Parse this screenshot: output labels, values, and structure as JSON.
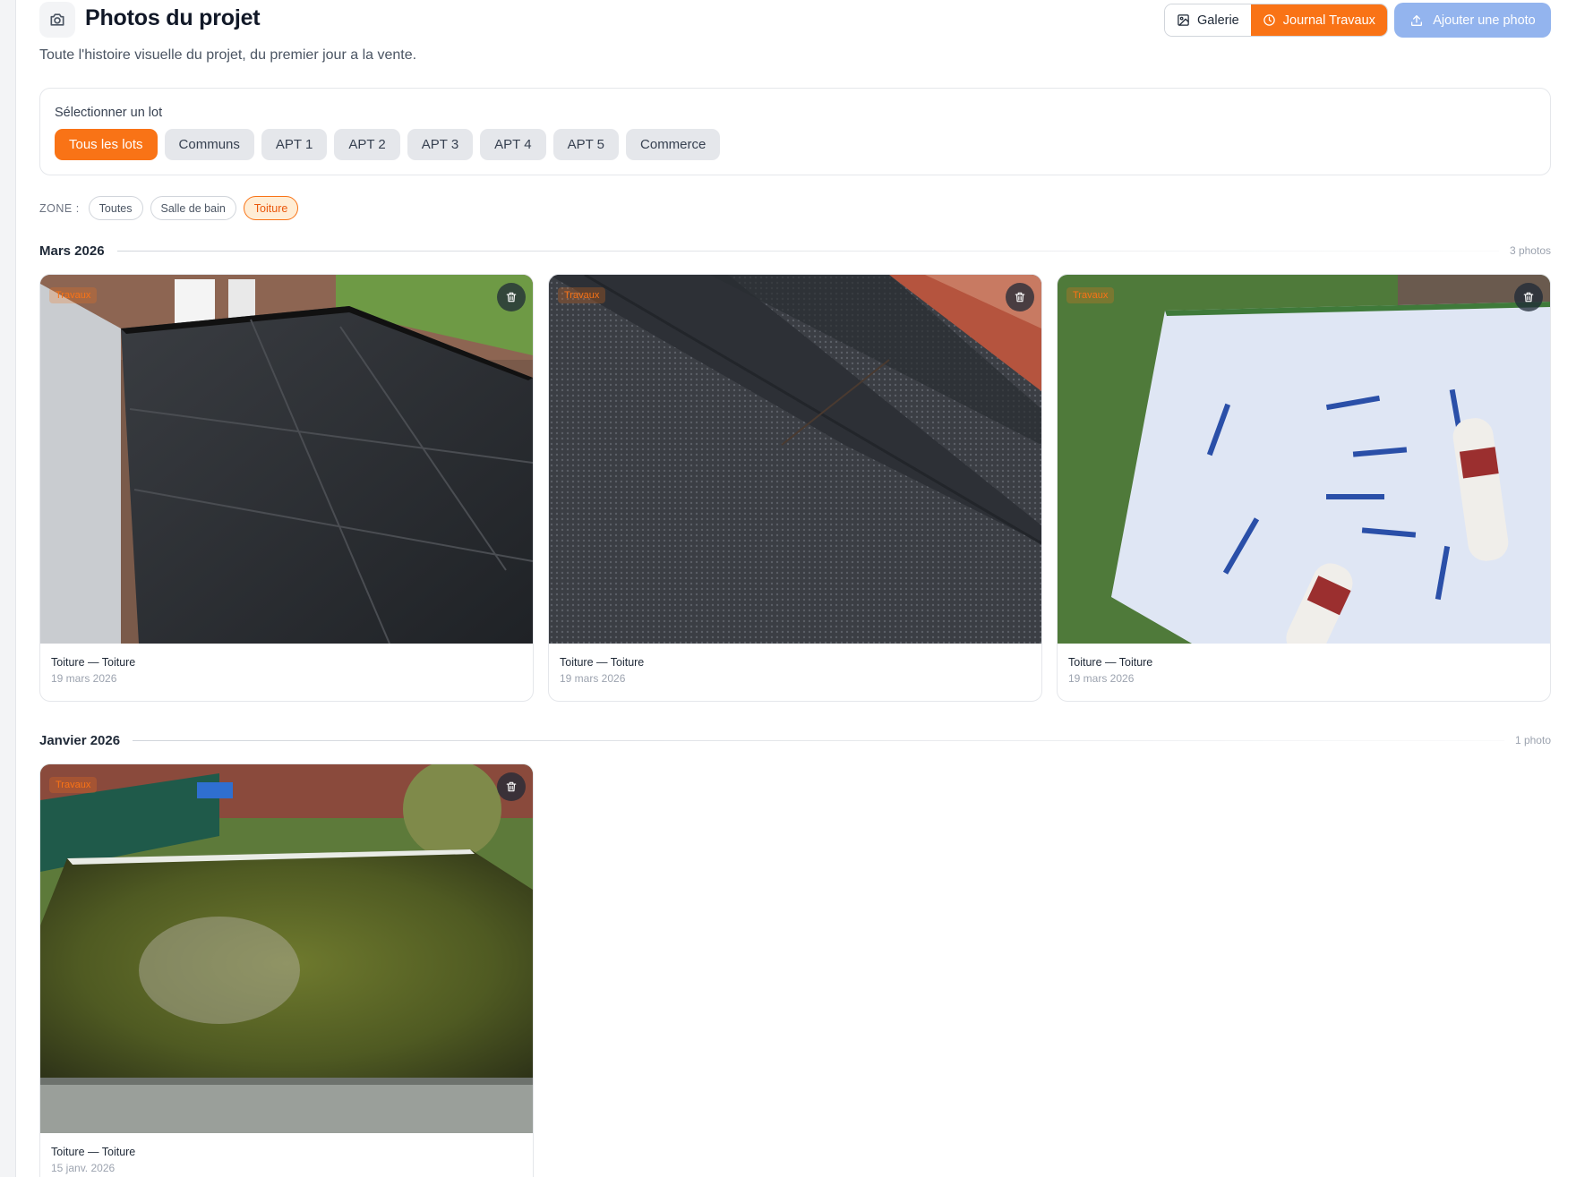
{
  "header": {
    "title": "Photos du projet",
    "subtitle": "Toute l'histoire visuelle du projet, du premier jour a la vente.",
    "views": [
      {
        "label": "Galerie",
        "icon": "image-icon",
        "active": false
      },
      {
        "label": "Journal Travaux",
        "icon": "clock-icon",
        "active": true
      }
    ],
    "add_button": {
      "label": "Ajouter une photo",
      "icon": "upload-icon"
    }
  },
  "lots": {
    "label": "Sélectionner un lot",
    "items": [
      {
        "label": "Tous les lots",
        "active": true
      },
      {
        "label": "Communs",
        "active": false
      },
      {
        "label": "APT 1",
        "active": false
      },
      {
        "label": "APT 2",
        "active": false
      },
      {
        "label": "APT 3",
        "active": false
      },
      {
        "label": "APT 4",
        "active": false
      },
      {
        "label": "APT 5",
        "active": false
      },
      {
        "label": "Commerce",
        "active": false
      }
    ]
  },
  "zones": {
    "label": "ZONE :",
    "items": [
      {
        "label": "Toutes",
        "active": false
      },
      {
        "label": "Salle de bain",
        "active": false
      },
      {
        "label": "Toiture",
        "active": true
      }
    ]
  },
  "months": [
    {
      "title": "Mars 2026",
      "count": "3 photos",
      "photos": [
        {
          "badge": "Travaux",
          "caption": "Toiture — Toiture",
          "date": "19 mars 2026"
        },
        {
          "badge": "Travaux",
          "caption": "Toiture — Toiture",
          "date": "19 mars 2026"
        },
        {
          "badge": "Travaux",
          "caption": "Toiture — Toiture",
          "date": "19 mars 2026"
        }
      ]
    },
    {
      "title": "Janvier 2026",
      "count": "1 photo",
      "photos": [
        {
          "badge": "Travaux",
          "caption": "Toiture — Toiture",
          "date": "15 janv. 2026"
        }
      ]
    }
  ],
  "colors": {
    "accent": "#f97316",
    "add_button": "#93b4ee",
    "chip_inactive": "#e5e7eb"
  }
}
